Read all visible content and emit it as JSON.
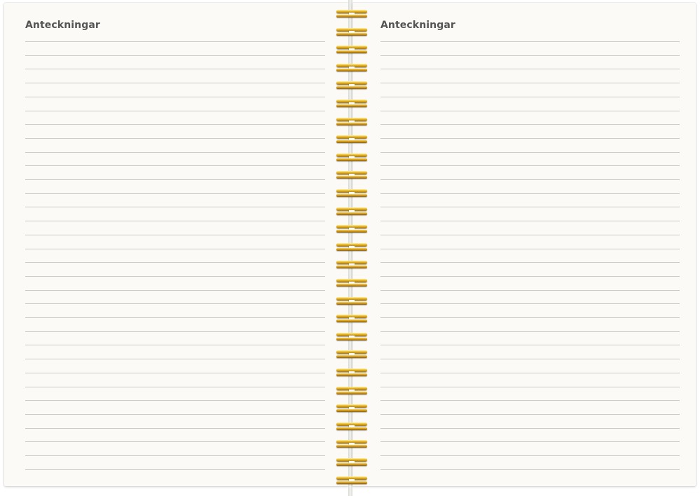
{
  "left_page": {
    "title": "Anteckningar"
  },
  "right_page": {
    "title": "Anteckningar"
  },
  "colors": {
    "paper": "#fbfaf6",
    "rule": "#c9c9c6",
    "title": "#555555",
    "binding": "#e7b422"
  },
  "ruled_lines_per_page": 32,
  "binding_coils": 27
}
